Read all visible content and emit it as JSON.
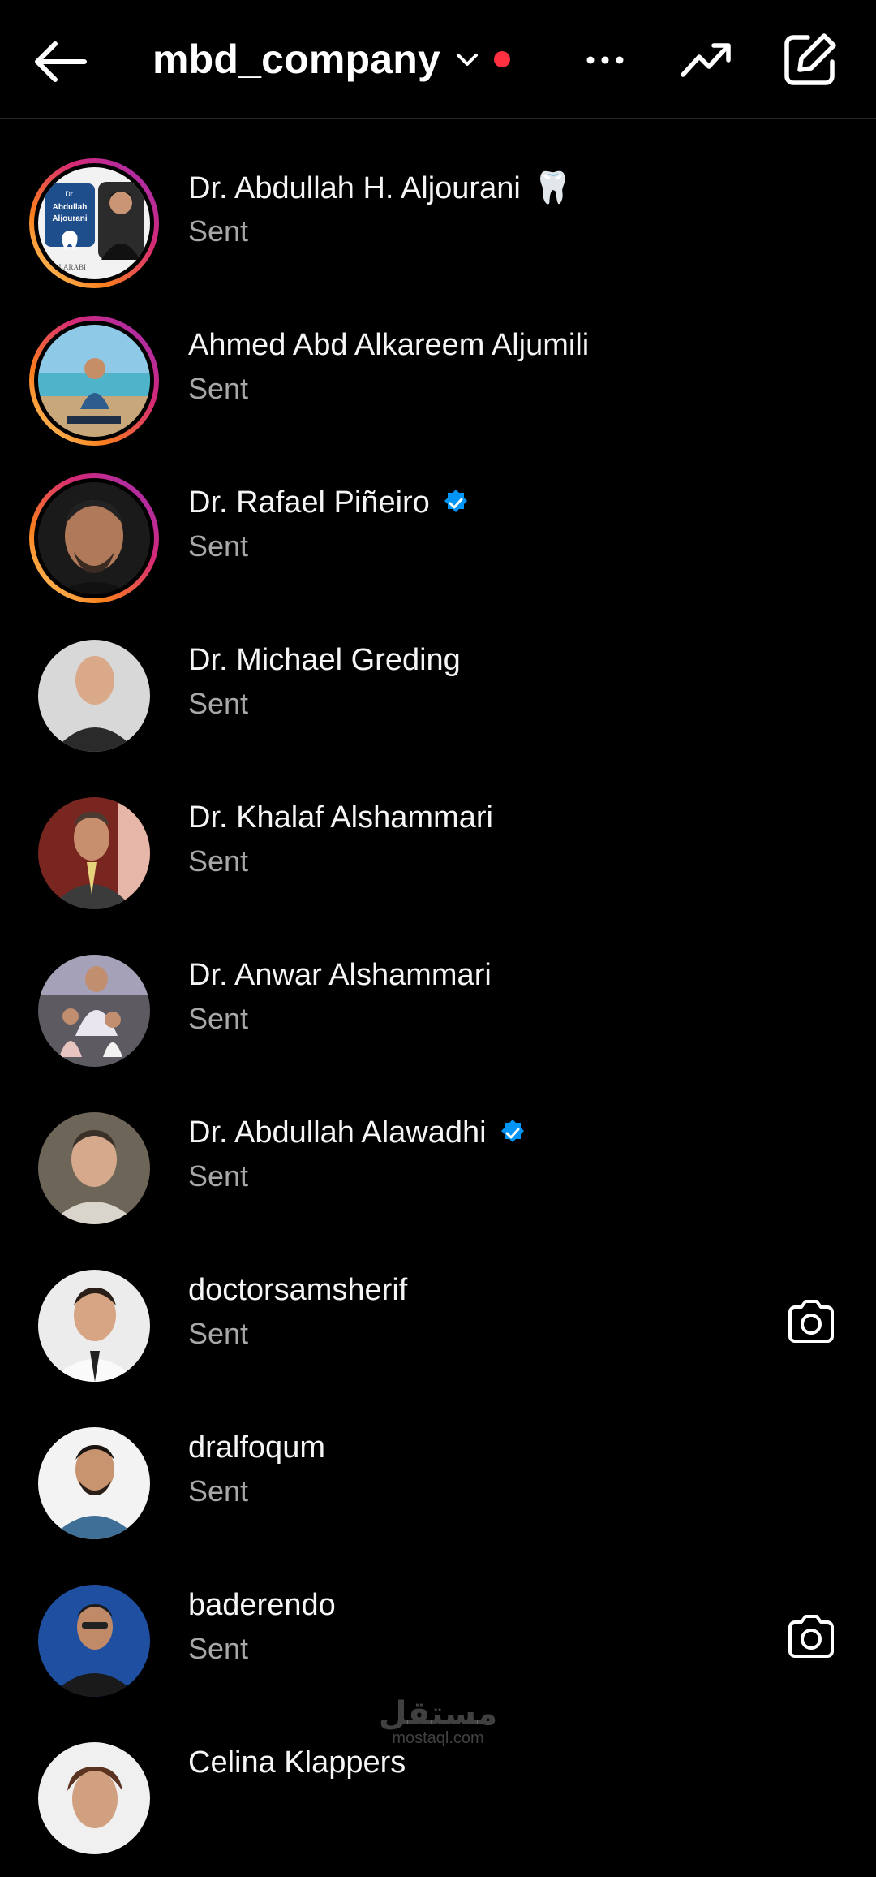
{
  "header": {
    "account_name": "mbd_company",
    "icons": [
      "back-arrow-icon",
      "chevron-down-icon",
      "notification-dot",
      "more-icon",
      "trending-icon",
      "compose-icon"
    ]
  },
  "threads": [
    {
      "name": "Dr. Abdullah H. Aljourani",
      "emoji": "🦷",
      "status": "Sent",
      "story_ring": true,
      "verified": false,
      "camera": false,
      "avatar_text": [
        "Dr.",
        "Abdullah",
        "Aljourani",
        "ALARABI"
      ]
    },
    {
      "name": "Ahmed Abd Alkareem Aljumili",
      "status": "Sent",
      "story_ring": true,
      "verified": false,
      "camera": false
    },
    {
      "name": "Dr. Rafael Piñeiro",
      "status": "Sent",
      "story_ring": true,
      "verified": true,
      "camera": false
    },
    {
      "name": "Dr. Michael Greding",
      "status": "Sent",
      "story_ring": false,
      "verified": false,
      "camera": false
    },
    {
      "name": "Dr. Khalaf Alshammari",
      "status": "Sent",
      "story_ring": false,
      "verified": false,
      "camera": false
    },
    {
      "name": "Dr. Anwar Alshammari",
      "status": "Sent",
      "story_ring": false,
      "verified": false,
      "camera": false
    },
    {
      "name": "Dr. Abdullah Alawadhi",
      "status": "Sent",
      "story_ring": false,
      "verified": true,
      "camera": false
    },
    {
      "name": "doctorsamsherif",
      "status": "Sent",
      "story_ring": false,
      "verified": false,
      "camera": true
    },
    {
      "name": "dralfoqum",
      "status": "Sent",
      "story_ring": false,
      "verified": false,
      "camera": false
    },
    {
      "name": "baderendo",
      "status": "Sent",
      "story_ring": false,
      "verified": false,
      "camera": true
    },
    {
      "name": "Celina Klappers",
      "status": "",
      "story_ring": false,
      "verified": false,
      "camera": false
    }
  ],
  "watermark": {
    "arabic": "مستقل",
    "latin": "mostaql.com"
  },
  "colors": {
    "background": "#000000",
    "secondary_text": "#a8a8a8",
    "verified_blue": "#0095f6",
    "notification_red": "#ff3040"
  }
}
